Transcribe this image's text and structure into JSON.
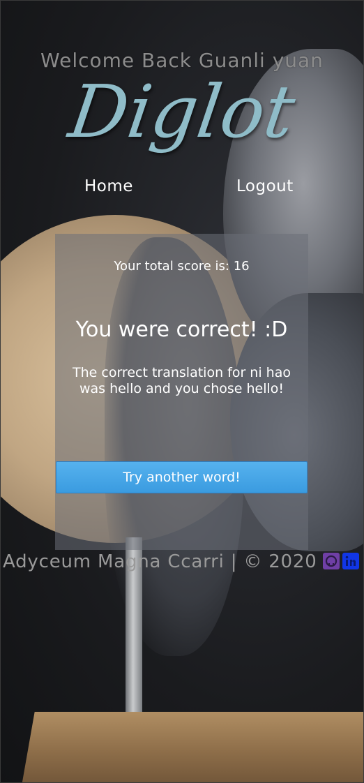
{
  "header": {
    "welcome": "Welcome Back Guanli yuan",
    "logo": "Diglot"
  },
  "nav": {
    "home": "Home",
    "logout": "Logout"
  },
  "card": {
    "score_text": "Your total score is: 16",
    "result_title": "You were correct! :D",
    "result_detail": "The correct translation for ni hao was hello and you chose hello!",
    "button_label": "Try another word!"
  },
  "footer": {
    "text": "Adyceum Magna Ccarri | © 2020",
    "icons": [
      "github-icon",
      "linkedin-icon"
    ]
  },
  "colors": {
    "logo": "#8fbcc8",
    "button": "#3a9be0",
    "github": "#6f3fa6",
    "linkedin": "#1136e6"
  }
}
